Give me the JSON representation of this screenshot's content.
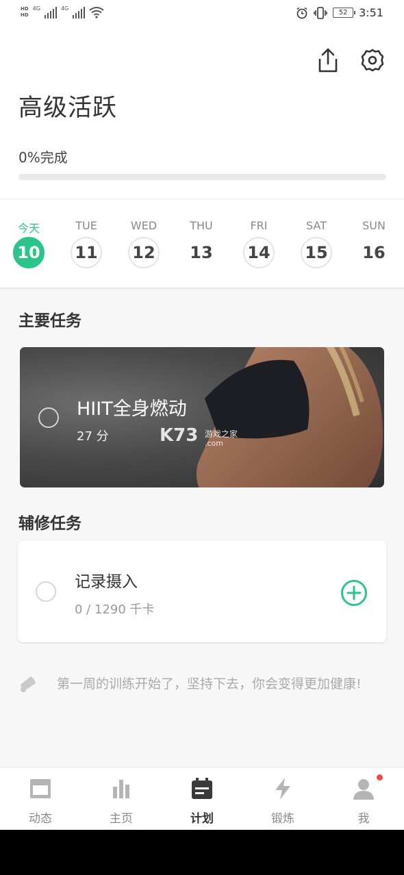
{
  "status_bar": {
    "hd_top": "HD",
    "hd_bottom": "HD",
    "net1": "4G",
    "net2": "4G",
    "battery": "52",
    "time": "3:51"
  },
  "header": {
    "title": "高级活跃",
    "progress_text": "0%完成",
    "progress_fraction": 0.0
  },
  "week": [
    {
      "label": "今天",
      "num": "10",
      "state": "today"
    },
    {
      "label": "TUE",
      "num": "11",
      "state": "ring"
    },
    {
      "label": "WED",
      "num": "12",
      "state": "ring"
    },
    {
      "label": "THU",
      "num": "13",
      "state": "plain"
    },
    {
      "label": "FRI",
      "num": "14",
      "state": "ring"
    },
    {
      "label": "SAT",
      "num": "15",
      "state": "ring"
    },
    {
      "label": "SUN",
      "num": "16",
      "state": "plain"
    }
  ],
  "main_tasks": {
    "title": "主要任务",
    "item": {
      "name": "HIIT全身燃动",
      "duration": "27 分"
    },
    "watermark": {
      "logo": "K73",
      "site": "游戏之家",
      "domain": ".com"
    }
  },
  "sub_tasks": {
    "title": "辅修任务",
    "item": {
      "name": "记录摄入",
      "meta": "0 / 1290 千卡"
    }
  },
  "tip": {
    "text": "第一周的训练开始了，坚持下去，你会变得更加健康!"
  },
  "bottom_nav": [
    {
      "label": "动态",
      "icon": "feed-icon",
      "active": false
    },
    {
      "label": "主页",
      "icon": "bar-chart-icon",
      "active": false
    },
    {
      "label": "计划",
      "icon": "calendar-icon",
      "active": true
    },
    {
      "label": "锻炼",
      "icon": "lightning-icon",
      "active": false
    },
    {
      "label": "我",
      "icon": "person-icon",
      "active": false,
      "badge": true
    }
  ],
  "colors": {
    "accent": "#2bc48a",
    "badge": "#ef4a4a"
  }
}
